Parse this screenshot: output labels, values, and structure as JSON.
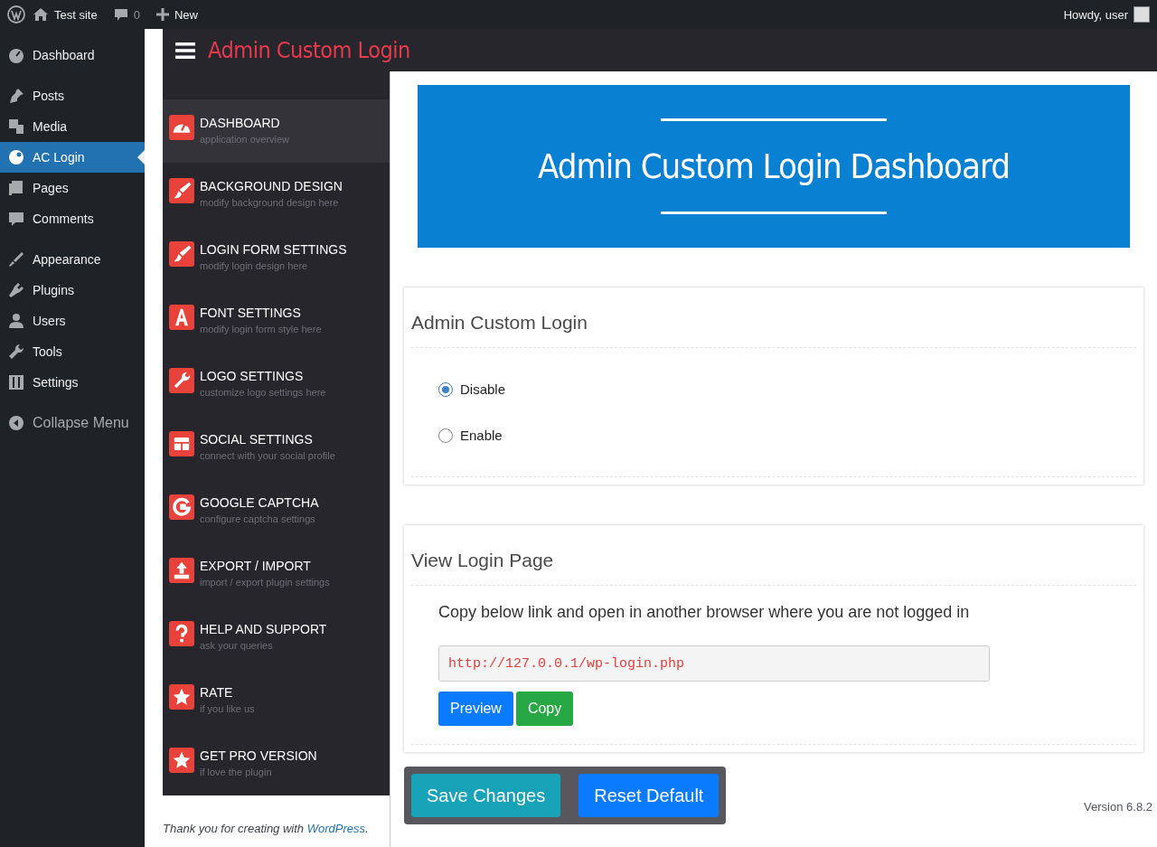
{
  "admin_bar": {
    "site": "Test site",
    "comments": "0",
    "new": "New",
    "greeting": "Howdy, user"
  },
  "wp_menu": {
    "groups": [
      [
        {
          "label": "Dashboard",
          "selected": false
        }
      ],
      [
        {
          "label": "Posts",
          "selected": false
        },
        {
          "label": "Media",
          "selected": false
        },
        {
          "label": "AC Login",
          "selected": true
        },
        {
          "label": "Pages",
          "selected": false
        },
        {
          "label": "Comments",
          "selected": false
        }
      ],
      [
        {
          "label": "Appearance",
          "selected": false
        },
        {
          "label": "Plugins",
          "selected": false
        },
        {
          "label": "Users",
          "selected": false
        },
        {
          "label": "Tools",
          "selected": false
        },
        {
          "label": "Settings",
          "selected": false
        }
      ]
    ],
    "collapse": "Collapse Menu"
  },
  "plugin": {
    "title": "Admin Custom Login",
    "nav": [
      {
        "title": "DASHBOARD",
        "subtitle": "application overview",
        "selected": true
      },
      {
        "title": "BACKGROUND DESIGN",
        "subtitle": "modify background design here",
        "selected": false
      },
      {
        "title": "LOGIN FORM SETTINGS",
        "subtitle": "modify login design here",
        "selected": false
      },
      {
        "title": "FONT SETTINGS",
        "subtitle": "modify login form style here",
        "selected": false
      },
      {
        "title": "LOGO SETTINGS",
        "subtitle": "customize logo settings here",
        "selected": false
      },
      {
        "title": "SOCIAL SETTINGS",
        "subtitle": "connect with your social profile",
        "selected": false
      },
      {
        "title": "GOOGLE CAPTCHA",
        "subtitle": "configure captcha settings",
        "selected": false
      },
      {
        "title": "EXPORT / IMPORT",
        "subtitle": "import / export plugin settings",
        "selected": false
      },
      {
        "title": "HELP AND SUPPORT",
        "subtitle": "ask your queries",
        "selected": false
      },
      {
        "title": "RATE",
        "subtitle": "if you like us",
        "selected": false
      },
      {
        "title": "GET PRO VERSION",
        "subtitle": "if love the plugin",
        "selected": false
      }
    ],
    "banner": "Admin Custom Login Dashboard",
    "status_card": {
      "title": "Admin Custom Login",
      "options": [
        {
          "label": "Disable",
          "selected": true
        },
        {
          "label": "Enable",
          "selected": false
        }
      ]
    },
    "view_card": {
      "title": "View Login Page",
      "text": "Copy below link and open in another browser where you are not logged in",
      "url": "http://127.0.0.1/wp-login.php",
      "buttons": [
        "Preview",
        "Copy"
      ]
    },
    "actions": [
      "Save Changes",
      "Reset Default"
    ]
  },
  "footer": {
    "text": "Thank you for creating with",
    "link": "WordPress",
    "end": ".",
    "version": "Version 6.8.2"
  }
}
